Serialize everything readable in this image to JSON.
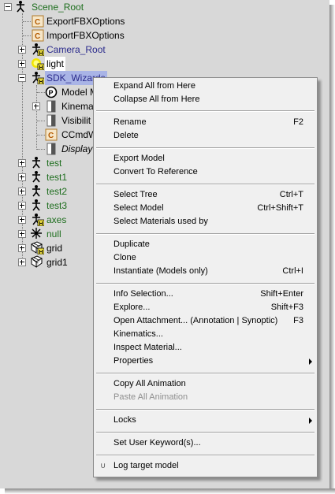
{
  "tree": {
    "root": "Scene_Root",
    "root_children": [
      {
        "label": "ExportFBXOptions",
        "color": "black",
        "icon": "c-icon"
      },
      {
        "label": "ImportFBXOptions",
        "color": "black",
        "icon": "c-icon"
      },
      {
        "label": "Camera_Root",
        "color": "blue",
        "icon": "camera-rig-icon"
      },
      {
        "label": "light",
        "color": "black",
        "icon": "light-icon"
      },
      {
        "label": "SDK_Wizards",
        "color": "blue",
        "icon": "model-icon"
      }
    ],
    "sdk_children": [
      {
        "label": "Model M",
        "icon": "property-p-icon"
      },
      {
        "label": "Kinemat",
        "icon": "kinematics-icon"
      },
      {
        "label": "Visibilit",
        "icon": "visibility-icon"
      },
      {
        "label": "CCmdW",
        "icon": "c-icon"
      },
      {
        "label": "Display",
        "icon": "display-icon"
      }
    ],
    "more_children": [
      {
        "label": "test",
        "icon": "null-figure-icon"
      },
      {
        "label": "test1",
        "icon": "null-figure-icon"
      },
      {
        "label": "test2",
        "icon": "null-figure-icon"
      },
      {
        "label": "test3",
        "icon": "null-figure-icon"
      },
      {
        "label": "axes",
        "icon": "model-icon"
      },
      {
        "label": "null",
        "icon": "null-icon"
      },
      {
        "label": "grid",
        "icon": "grid-model-icon"
      },
      {
        "label": "grid1",
        "icon": "grid-icon"
      }
    ]
  },
  "menu": {
    "expand_all": "Expand All from Here",
    "collapse_all": "Collapse All from Here",
    "rename": "Rename",
    "rename_shortcut": "F2",
    "delete": "Delete",
    "export_model": "Export Model",
    "convert_to_reference": "Convert To Reference",
    "select_tree": "Select Tree",
    "select_tree_shortcut": "Ctrl+T",
    "select_model": "Select Model",
    "select_model_shortcut": "Ctrl+Shift+T",
    "select_materials": "Select Materials used by",
    "duplicate": "Duplicate",
    "clone": "Clone",
    "instantiate": "Instantiate (Models only)",
    "instantiate_shortcut": "Ctrl+I",
    "info_selection": "Info Selection...",
    "info_selection_shortcut": "Shift+Enter",
    "explore": "Explore...",
    "explore_shortcut": "Shift+F3",
    "open_attachment": "Open Attachment... (Annotation | Synoptic)",
    "open_attachment_shortcut": "F3",
    "kinematics": "Kinematics...",
    "inspect_material": "Inspect Material...",
    "properties": "Properties",
    "copy_all_animation": "Copy All Animation",
    "paste_all_animation": "Paste All Animation",
    "locks": "Locks",
    "set_user_keywords": "Set User Keyword(s)...",
    "log_target_model": "Log target model",
    "log_icon_glyph": "∪"
  },
  "colors": {
    "tree_bg": "#d8d8d8",
    "label_green": "#1e6e1e",
    "label_blue": "#2a2a8c",
    "selection": "#a9b4e6",
    "menu_bg": "#f0f0f0"
  }
}
